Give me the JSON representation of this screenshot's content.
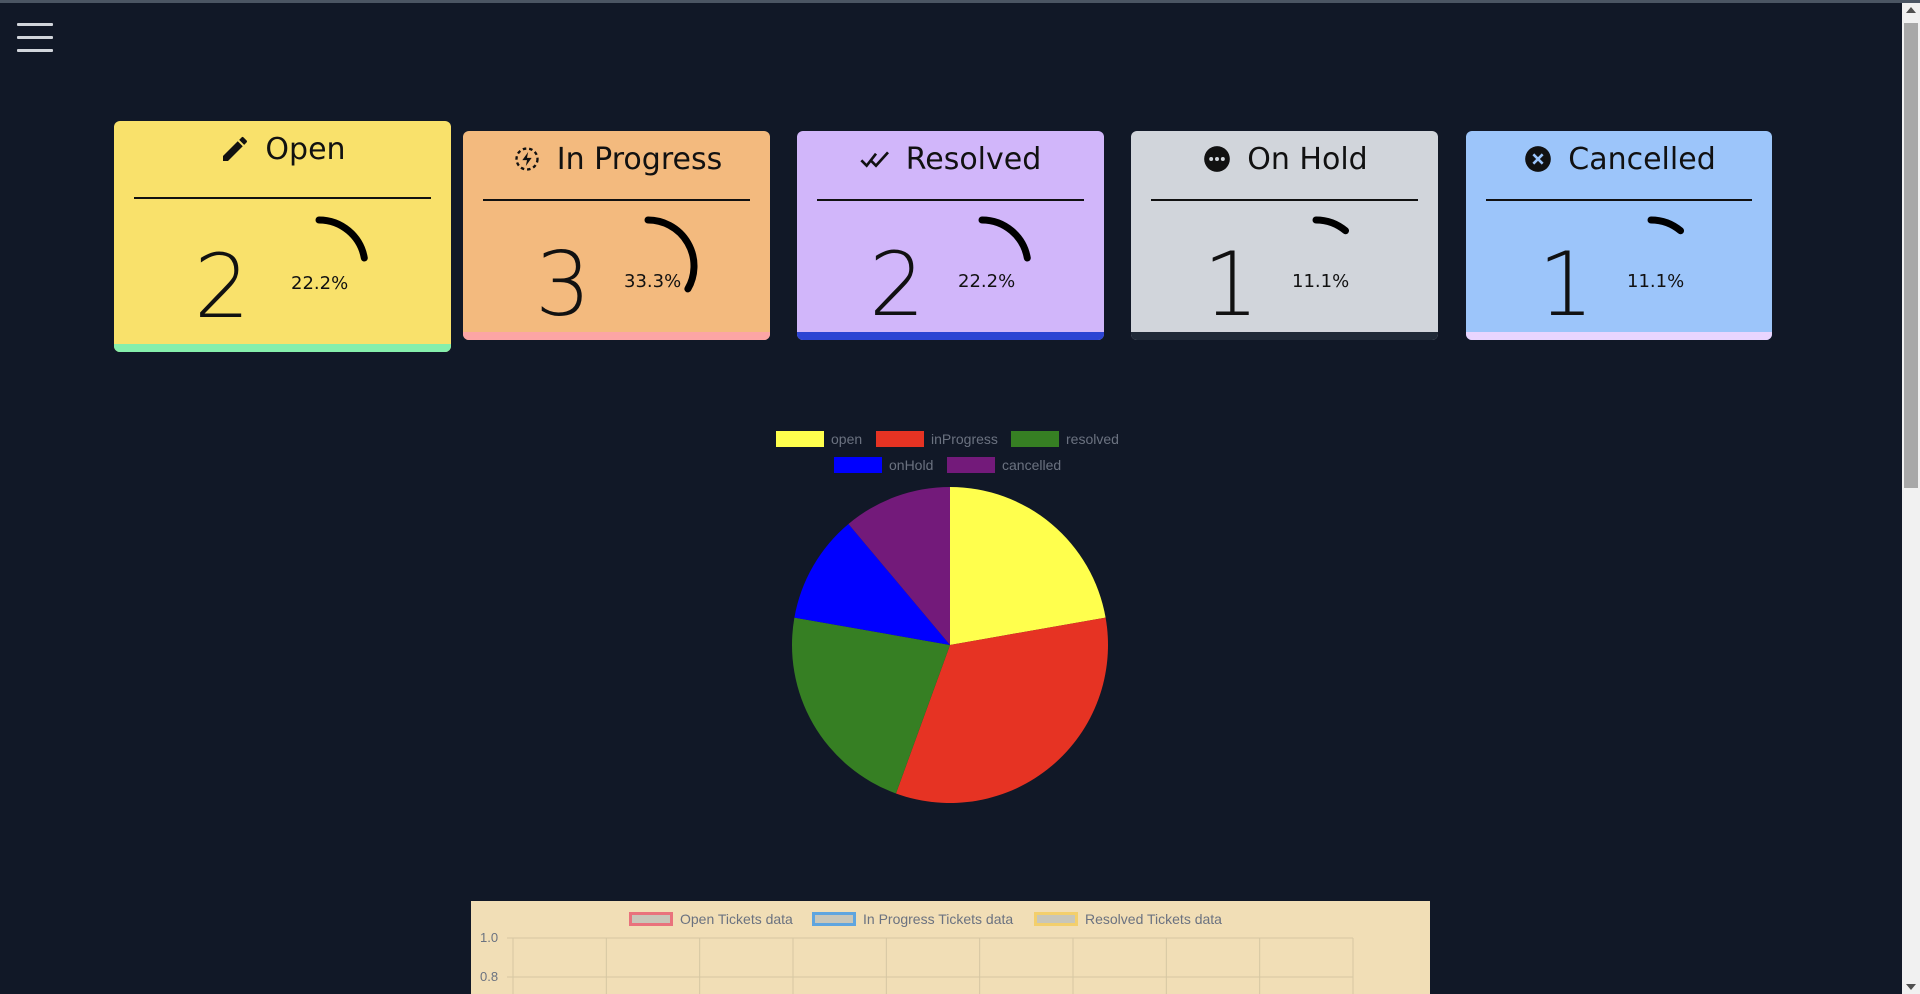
{
  "menu": {
    "icon": "hamburger-menu-icon"
  },
  "cards": [
    {
      "id": "open",
      "title": "Open",
      "icon": "pencil-icon",
      "count": "2",
      "percent_text": "22.2%",
      "fraction": 0.222,
      "bg": "#f9e16b",
      "bar": "#86efac"
    },
    {
      "id": "in-progress",
      "title": "In Progress",
      "icon": "progress-bolt-icon",
      "count": "3",
      "percent_text": "33.3%",
      "fraction": 0.333,
      "bg": "#f3ba7e",
      "bar": "#fca5a5"
    },
    {
      "id": "resolved",
      "title": "Resolved",
      "icon": "double-check-icon",
      "count": "2",
      "percent_text": "22.2%",
      "fraction": 0.222,
      "bg": "#d1b6fa",
      "bar": "#2c44d3"
    },
    {
      "id": "on-hold",
      "title": "On Hold",
      "icon": "more-dots-icon",
      "count": "1",
      "percent_text": "11.1%",
      "fraction": 0.111,
      "bg": "#d1d5db",
      "bar": "#1f2937"
    },
    {
      "id": "cancelled",
      "title": "Cancelled",
      "icon": "close-circle-icon",
      "count": "1",
      "percent_text": "11.1%",
      "fraction": 0.111,
      "bg": "#9cc5fa",
      "bar": "#e9d5ff"
    }
  ],
  "chart_data": [
    {
      "type": "pie",
      "legend": [
        "open",
        "inProgress",
        "resolved",
        "onHold",
        "cancelled"
      ],
      "values": [
        2,
        3,
        2,
        1,
        1
      ],
      "colors": [
        "#ffff4d",
        "#e63323",
        "#367f23",
        "#0000ff",
        "#731a7a"
      ],
      "legend_position": "top"
    },
    {
      "type": "line",
      "series": [
        {
          "name": "Open Tickets data",
          "color": "#e9727c"
        },
        {
          "name": "In Progress Tickets data",
          "color": "#5fa5df"
        },
        {
          "name": "Resolved Tickets data",
          "color": "#f3cf6c"
        }
      ],
      "y_ticks": [
        "1.0",
        "0.8"
      ],
      "grid": true,
      "legend_position": "top",
      "background": "#f1deb6"
    }
  ]
}
